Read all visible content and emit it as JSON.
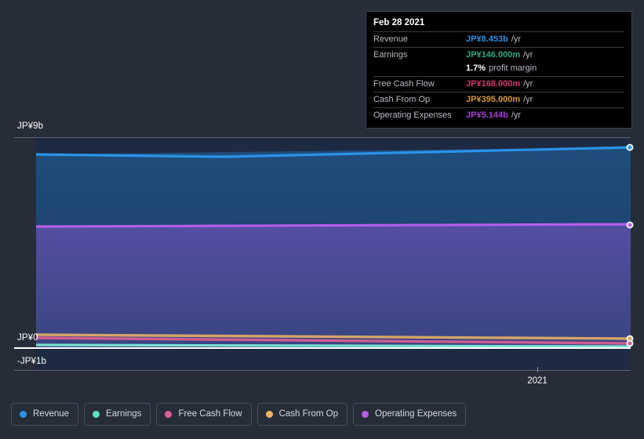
{
  "axis": {
    "y_top_label": "JP¥9b",
    "y_zero_label": "JP¥0",
    "y_bottom_label": "-JP¥1b",
    "x_tick_label": "2021"
  },
  "tooltip": {
    "date": "Feb 28 2021",
    "rows": [
      {
        "label": "Revenue",
        "value": "JP¥8.453b",
        "unit": "/yr",
        "color": "#2e8fe0"
      },
      {
        "label": "Earnings",
        "value": "JP¥146.000m",
        "unit": "/yr",
        "color": "#2faa7a"
      },
      {
        "label": "Free Cash Flow",
        "value": "JP¥168.000m",
        "unit": "/yr",
        "color": "#d6346e"
      },
      {
        "label": "Cash From Op",
        "value": "JP¥395.000m",
        "unit": "/yr",
        "color": "#d89a2a"
      },
      {
        "label": "Operating Expenses",
        "value": "JP¥5.144b",
        "unit": "/yr",
        "color": "#a93ed8"
      }
    ],
    "margin_value": "1.7%",
    "margin_label": "profit margin"
  },
  "legend": {
    "items": [
      {
        "label": "Revenue",
        "color": "#2a93e8"
      },
      {
        "label": "Earnings",
        "color": "#5fe3c0"
      },
      {
        "label": "Free Cash Flow",
        "color": "#e0608f"
      },
      {
        "label": "Cash From Op",
        "color": "#f0b45e"
      },
      {
        "label": "Operating Expenses",
        "color": "#b55ee8"
      }
    ]
  },
  "chart_data": {
    "type": "area",
    "title": "",
    "xlabel": "",
    "ylabel": "",
    "ylim": [
      -1.0,
      9.0
    ],
    "y_unit": "JP¥ billions",
    "grid": true,
    "legend_position": "bottom",
    "x": [
      "2020-02-29",
      "2021-02-28"
    ],
    "x_tick_values": [
      "2021"
    ],
    "hover_point": "Feb 28 2021",
    "series": [
      {
        "name": "Revenue",
        "color": "#2a93e8",
        "values": [
          8.15,
          8.453
        ]
      },
      {
        "name": "Operating Expenses",
        "color": "#b55ee8",
        "values": [
          5.05,
          5.144
        ]
      },
      {
        "name": "Cash From Op",
        "color": "#f0b45e",
        "values": [
          0.53,
          0.395
        ]
      },
      {
        "name": "Free Cash Flow",
        "color": "#e0608f",
        "values": [
          0.4,
          0.168
        ]
      },
      {
        "name": "Earnings",
        "color": "#5fe3c0",
        "values": [
          0.1,
          0.146
        ]
      }
    ]
  }
}
